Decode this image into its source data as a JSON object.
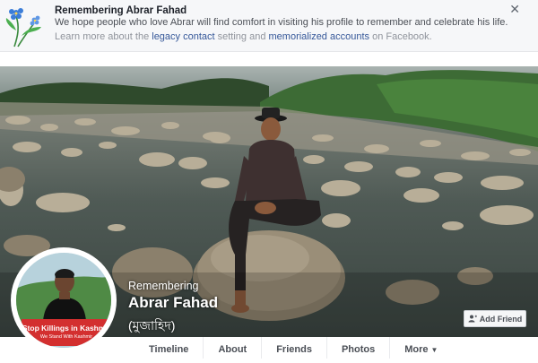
{
  "banner": {
    "title": "Remembering Abrar Fahad",
    "line1": "We hope people who love Abrar will find comfort in visiting his profile to remember and celebrate his life.",
    "line2_pre": "Learn more about the ",
    "legacy_link": "legacy contact",
    "line2_mid": " setting and ",
    "memorial_link": "memorialized accounts",
    "line2_post": " on Facebook.",
    "close": "✕",
    "flower_icon": "forget-me-not-flower-icon"
  },
  "profile": {
    "remembering": "Remembering",
    "name": "Abrar Fahad",
    "alt_name": "(মুজাহিদ)",
    "avatar_ribbon_line1": "Stop Killings in Kashmir",
    "avatar_ribbon_line2": "We Stand With Kashmir"
  },
  "actions": {
    "add_friend": "Add Friend"
  },
  "tabs": [
    {
      "label": "Timeline"
    },
    {
      "label": "About"
    },
    {
      "label": "Friends"
    },
    {
      "label": "Photos"
    },
    {
      "label": "More"
    }
  ],
  "colors": {
    "link": "#365899",
    "banner_bg": "#f6f7f9",
    "ribbon": "#d32f2f"
  }
}
